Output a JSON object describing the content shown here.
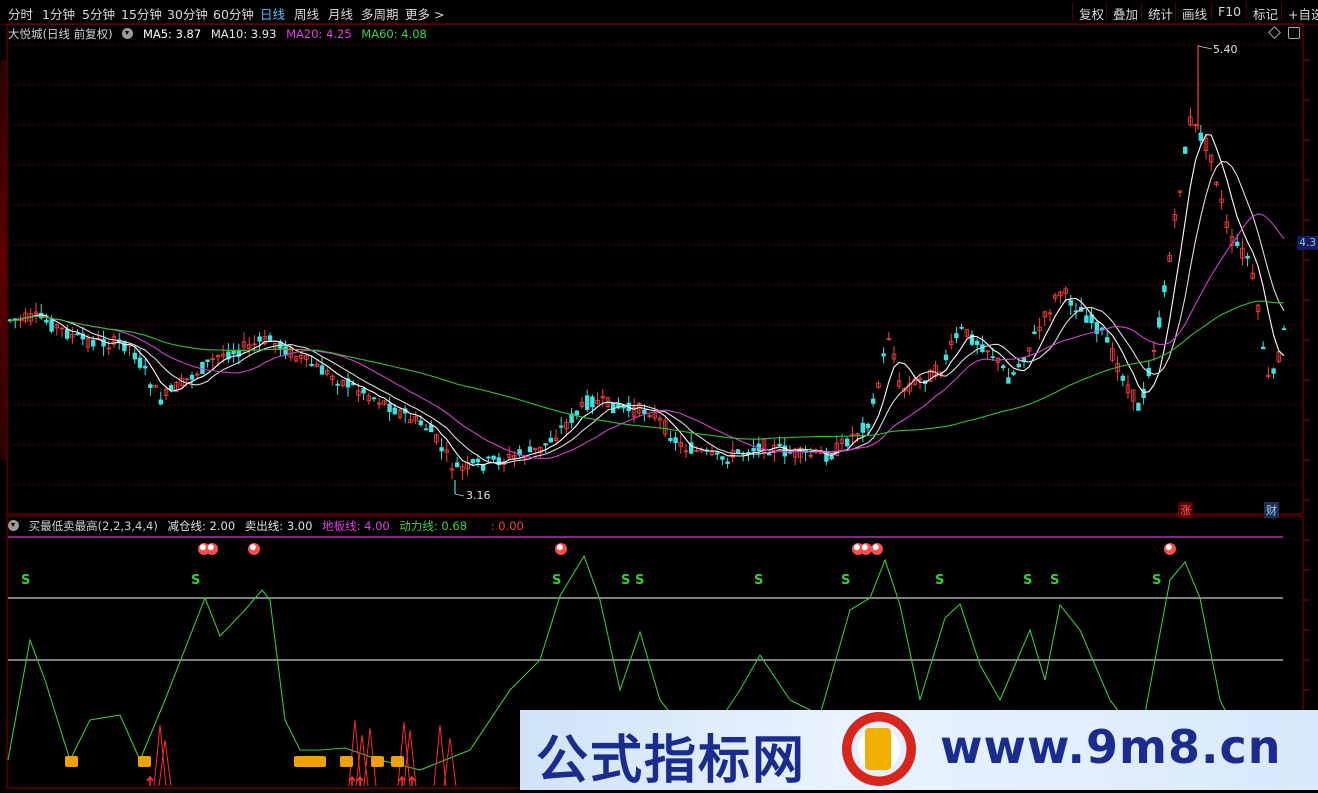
{
  "toolbar": {
    "periods": [
      "分时",
      "1分钟",
      "5分钟",
      "15分钟",
      "30分钟",
      "60分钟",
      "日线",
      "周线",
      "月线",
      "多周期",
      "更多 >"
    ],
    "active_period": "日线",
    "right_buttons": [
      "复权",
      "叠加",
      "统计",
      "画线",
      "F10",
      "标记",
      "+自选"
    ]
  },
  "main_chart": {
    "title": "大悦城(日线 前复权)",
    "ma5_label": "MA5: 3.87",
    "ma10_label": "MA10: 3.93",
    "ma20_label": "MA20: 4.25",
    "ma60_label": "MA60: 4.08",
    "high_label": "5.40",
    "low_label": "3.16",
    "right_price_tag": "4.3",
    "zhang_badge": "涨",
    "cai_badge": "财",
    "colors": {
      "ma5": "#ffffff",
      "ma10": "#e8e800",
      "ma20": "#d040d0",
      "ma60": "#30c030",
      "up": "#ff4040",
      "down": "#40e0e0",
      "grid": "#5a0000"
    }
  },
  "indicator": {
    "title": "买最低卖最高(2,2,3,4,4)",
    "jiancang_label": "减仓线: 2.00",
    "maichu_label": "卖出线: 3.00",
    "diban_label": "地板线: 4.00",
    "dongli_label": "动力线: 0.68",
    "extra_label": ": 0.00",
    "s_marker": "S"
  },
  "watermark": {
    "brand_cn": "公式指标网",
    "url": "www.9m8.cn"
  }
}
